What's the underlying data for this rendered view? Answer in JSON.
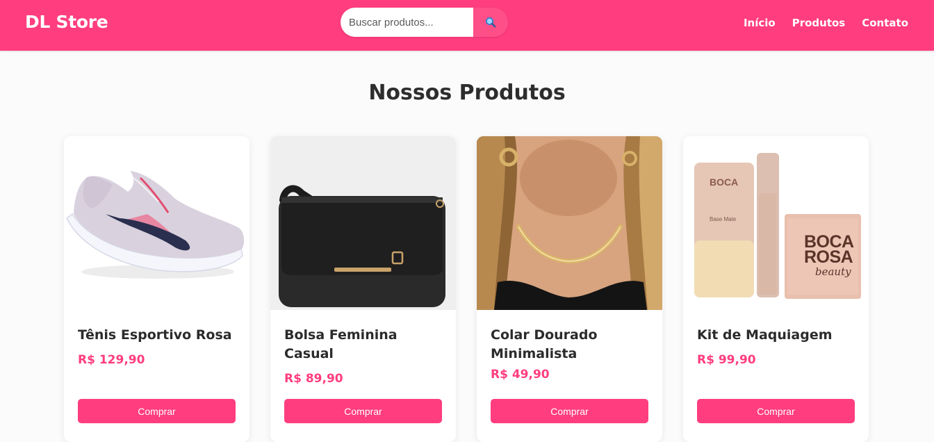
{
  "header": {
    "logo": "DL Store",
    "search_placeholder": "Buscar produtos...",
    "nav": [
      "Início",
      "Produtos",
      "Contato"
    ]
  },
  "main": {
    "title": "Nossos Produtos",
    "products": [
      {
        "name": "Tênis Esportivo Rosa",
        "price": "R$ 129,90",
        "button": "Comprar"
      },
      {
        "name": "Bolsa Feminina Casual",
        "price": "R$ 89,90",
        "button": "Comprar"
      },
      {
        "name": "Colar Dourado Minimalista",
        "price": "R$ 49,90",
        "button": "Comprar"
      },
      {
        "name": "Kit de Maquiagem",
        "price": "R$ 99,90",
        "button": "Comprar"
      }
    ],
    "image_text": {
      "brand_line1": "BOCA",
      "brand_line2": "ROSA",
      "brand_sub": "beauty",
      "tube_label": "Base Mate"
    }
  },
  "colors": {
    "accent": "#ff3d7f",
    "text": "#2b2b2b",
    "background": "#fbfbfb"
  }
}
